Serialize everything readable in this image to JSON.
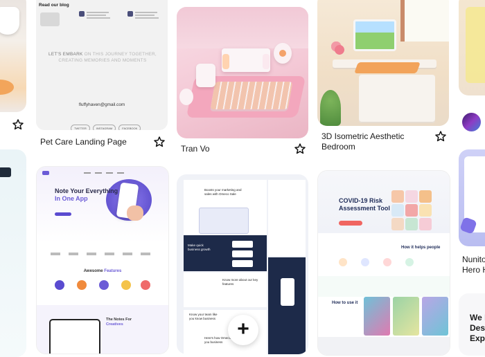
{
  "pins": {
    "blog": {
      "heading": "Read our blog",
      "embark_line1_dark": "LET'S EMBARK",
      "embark_line1_light": " ON THIS JOURNEY TOGETHER,",
      "embark_line2": "CREATING MEMORIES AND MOMENTS",
      "email": "fluffyhaven@gmail.com",
      "socials": [
        "TWITTER",
        "INSTAGRAM",
        "FACEBOOK"
      ],
      "caption": "Pet Care Landing Page"
    },
    "switch": {
      "caption": "Tran Vo"
    },
    "bedroom": {
      "caption": "3D Isometric Aesthetic Bedroom"
    },
    "notes_app": {
      "title_line1": "Note Your Everything",
      "title_line2_accent": "In One App",
      "section_awesome_plain": "Awesome ",
      "section_awesome_accent": "Features",
      "notes_for_line1": "The Notes For",
      "notes_for_line2": "Creatives"
    },
    "dashboard": {
      "hero_title": "Boosts your marketing and sales with Omeco Sale",
      "dark_text": "Make quick business growth",
      "know_more": "Know more about our key features",
      "know_team": "Know your team like you know business",
      "bottom_text": "Here's how Omeco benefit you business"
    },
    "covid": {
      "title_line1": "COVID-19 Risk",
      "title_line2": "Assessment Tool",
      "how_helps": "How it helps people",
      "how_use": "How to use it"
    },
    "right_partial": {
      "caption": "Nunito Hero H",
      "partial_text": "We H Desig Expe"
    }
  },
  "fab": {
    "label": "+"
  },
  "colors": {
    "accent_purple": "#6b5bd6",
    "navy": "#1d2a49",
    "coral": "#f06560"
  }
}
